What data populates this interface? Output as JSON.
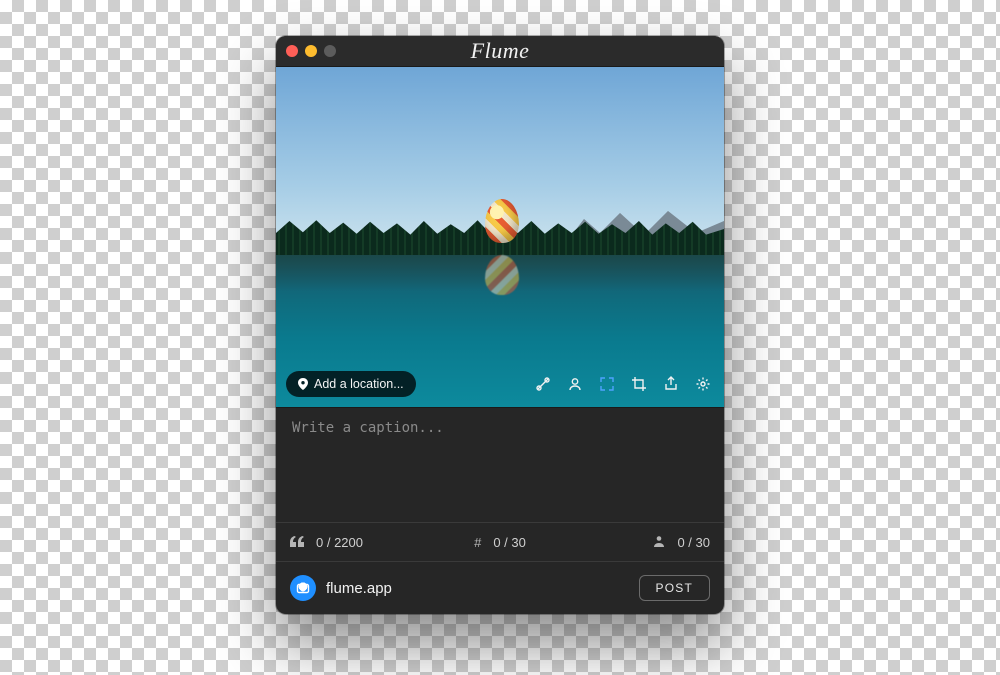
{
  "window": {
    "title": "Flume"
  },
  "photo": {
    "location_button_label": "Add a location..."
  },
  "caption": {
    "placeholder": "Write a caption...",
    "value": ""
  },
  "counters": {
    "caption": "0 / 2200",
    "hashtags": "0 / 30",
    "mentions": "0 / 30"
  },
  "account": {
    "username": "flume.app"
  },
  "actions": {
    "post_label": "POST"
  },
  "icons": {
    "pin": "pin-icon",
    "edit": "edit-icon",
    "tagPeople": "tag-people-icon",
    "resize": "resize-icon",
    "crop": "crop-icon",
    "share": "share-icon",
    "settings": "settings-icon",
    "quote": "quote-icon",
    "hash": "hash-icon",
    "person": "person-icon",
    "camera": "camera-icon"
  }
}
